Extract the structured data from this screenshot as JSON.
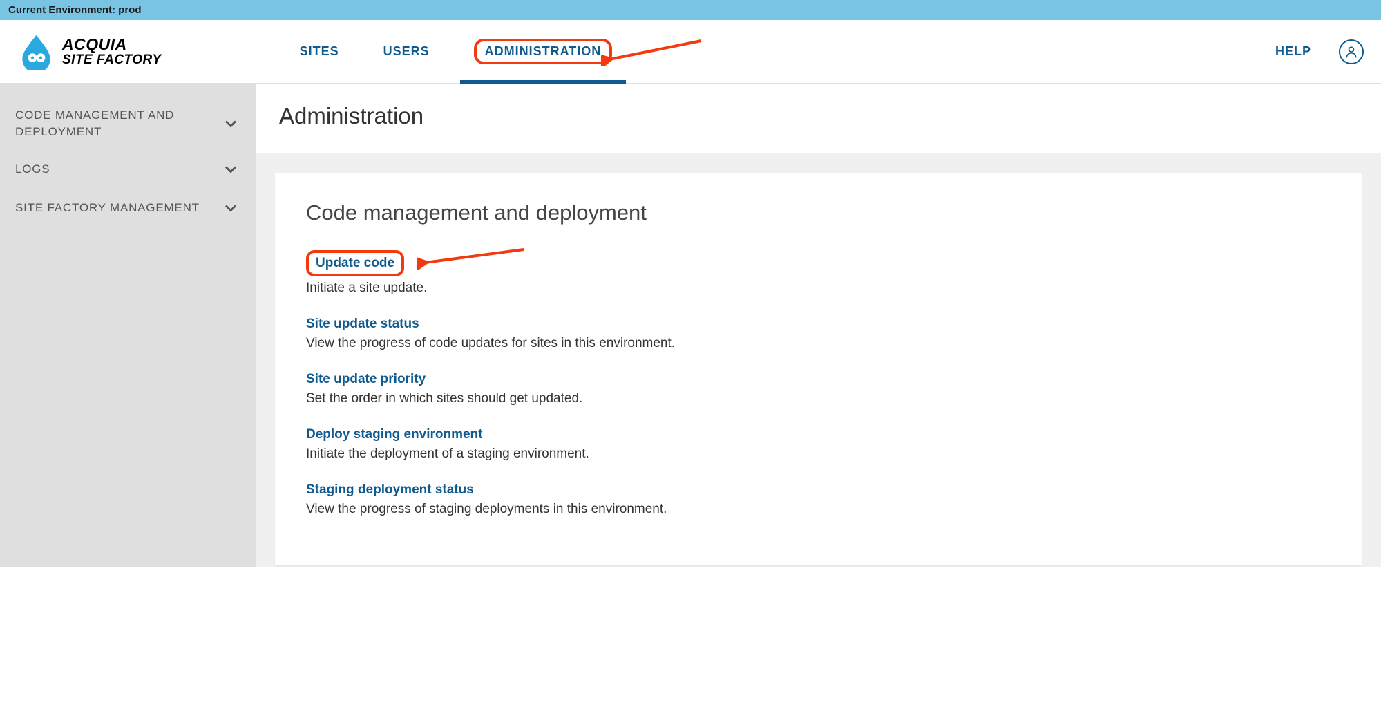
{
  "env_bar": {
    "label": "Current Environment: prod"
  },
  "logo": {
    "top": "ACQUIA",
    "bottom": "SITE FACTORY"
  },
  "nav": {
    "sites": "SITES",
    "users": "USERS",
    "administration": "ADMINISTRATION",
    "help": "HELP"
  },
  "sidebar": {
    "items": [
      {
        "label": "CODE MANAGEMENT AND DEPLOYMENT"
      },
      {
        "label": "LOGS"
      },
      {
        "label": "SITE FACTORY MANAGEMENT"
      }
    ]
  },
  "page": {
    "title": "Administration",
    "section_heading": "Code management and deployment",
    "options": [
      {
        "title": "Update code",
        "desc": "Initiate a site update.",
        "highlighted": true
      },
      {
        "title": "Site update status",
        "desc": "View the progress of code updates for sites in this environment."
      },
      {
        "title": "Site update priority",
        "desc": "Set the order in which sites should get updated."
      },
      {
        "title": "Deploy staging environment",
        "desc": "Initiate the deployment of a staging environment."
      },
      {
        "title": "Staging deployment status",
        "desc": "View the progress of staging deployments in this environment."
      }
    ]
  }
}
